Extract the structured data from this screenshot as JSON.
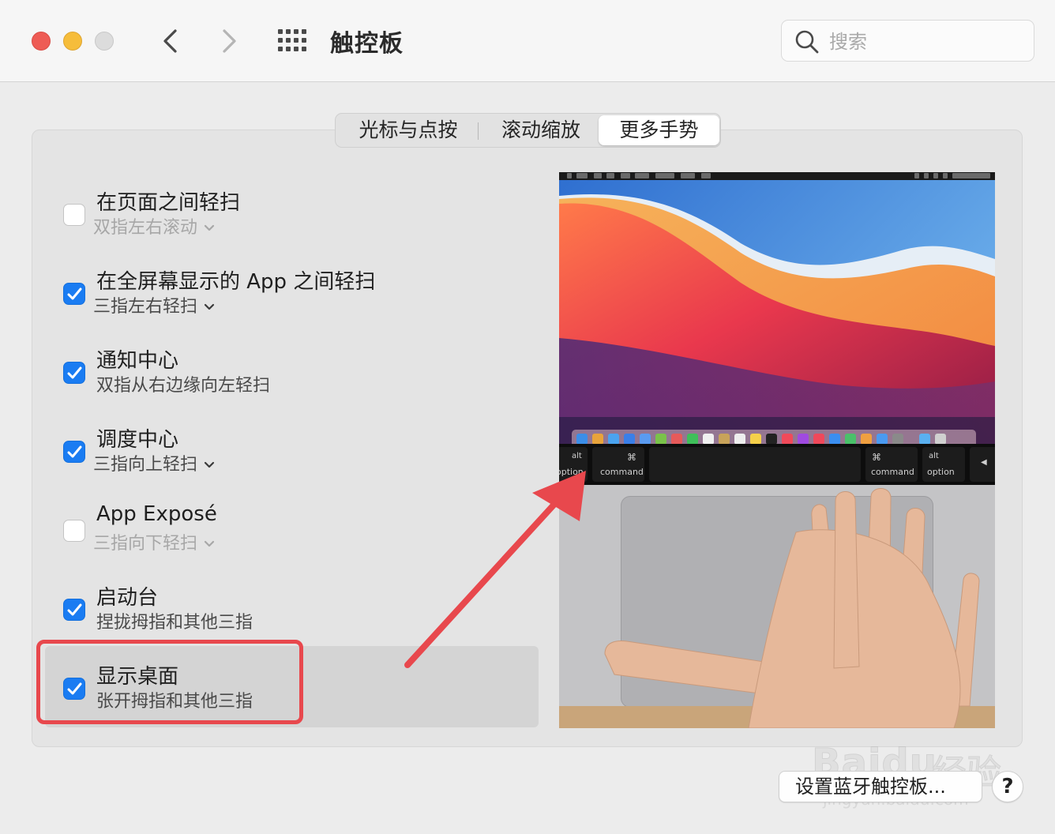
{
  "window": {
    "title": "触控板",
    "search_placeholder": "搜索"
  },
  "tabs": [
    {
      "label": "光标与点按",
      "selected": false
    },
    {
      "label": "滚动缩放",
      "selected": false
    },
    {
      "label": "更多手势",
      "selected": true
    }
  ],
  "gestures": [
    {
      "title": "在页面之间轻扫",
      "subtitle": "双指左右滚动",
      "checked": false,
      "has_dropdown": true
    },
    {
      "title": "在全屏幕显示的 App 之间轻扫",
      "subtitle": "三指左右轻扫",
      "checked": true,
      "has_dropdown": true
    },
    {
      "title": "通知中心",
      "subtitle": "双指从右边缘向左轻扫",
      "checked": true,
      "has_dropdown": false
    },
    {
      "title": "调度中心",
      "subtitle": "三指向上轻扫",
      "checked": true,
      "has_dropdown": true
    },
    {
      "title": "App Exposé",
      "subtitle": "三指向下轻扫",
      "checked": false,
      "has_dropdown": true
    },
    {
      "title": "启动台",
      "subtitle": "捏拢拇指和其他三指",
      "checked": true,
      "has_dropdown": false
    },
    {
      "title": "显示桌面",
      "subtitle": "张开拇指和其他三指",
      "checked": true,
      "has_dropdown": false,
      "highlighted": true
    }
  ],
  "preview_keys": {
    "left_alt": "alt",
    "left_option": "option",
    "left_cmd_symbol": "⌘",
    "left_command": "command",
    "right_cmd_symbol": "⌘",
    "right_command": "command",
    "right_alt": "alt",
    "right_option": "option",
    "arrow_left": "◀"
  },
  "footer": {
    "bluetooth_button": "设置蓝牙触控板...",
    "help_button": "?"
  },
  "watermark": {
    "brand": "Baidu",
    "cn": "经验",
    "url": "jingyan.baidu.com"
  },
  "colors": {
    "accent_checkbox": "#1a7cf2",
    "annotation_red": "#e8484d",
    "close": "#ee5c55",
    "minimize": "#f6bd3b"
  }
}
